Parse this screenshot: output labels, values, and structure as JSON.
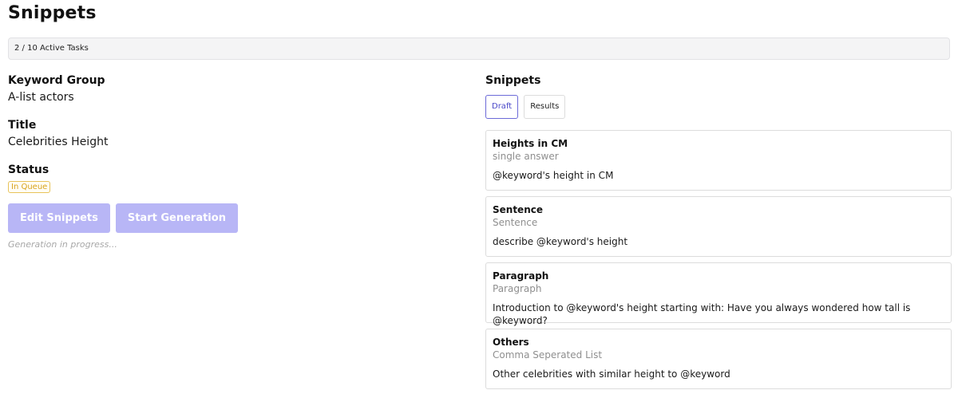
{
  "page": {
    "title": "Snippets",
    "active_tasks": "2 / 10 Active Tasks"
  },
  "details": {
    "keyword_group_label": "Keyword Group",
    "keyword_group_value": "A-list actors",
    "title_label": "Title",
    "title_value": "Celebrities Height",
    "status_label": "Status",
    "status_value": "In Queue",
    "status_color": "#d9a41c"
  },
  "actions": {
    "edit_label": "Edit Snippets",
    "start_label": "Start Generation",
    "progress_note": "Generation in progress...",
    "button_color": "#b8b6f6"
  },
  "snippets": {
    "title": "Snippets",
    "tabs": [
      {
        "label": "Draft",
        "active": true
      },
      {
        "label": "Results",
        "active": false
      }
    ],
    "items": [
      {
        "title": "Heights in CM",
        "type": "single answer",
        "prompt": "@keyword's height in CM"
      },
      {
        "title": "Sentence",
        "type": "Sentence",
        "prompt": "describe @keyword's height"
      },
      {
        "title": "Paragraph",
        "type": "Paragraph",
        "prompt": "Introduction to @keyword's height starting with: Have you always wondered how tall is @keyword?"
      },
      {
        "title": "Others",
        "type": "Comma Seperated List",
        "prompt": "Other celebrities with similar height to @keyword"
      }
    ]
  }
}
